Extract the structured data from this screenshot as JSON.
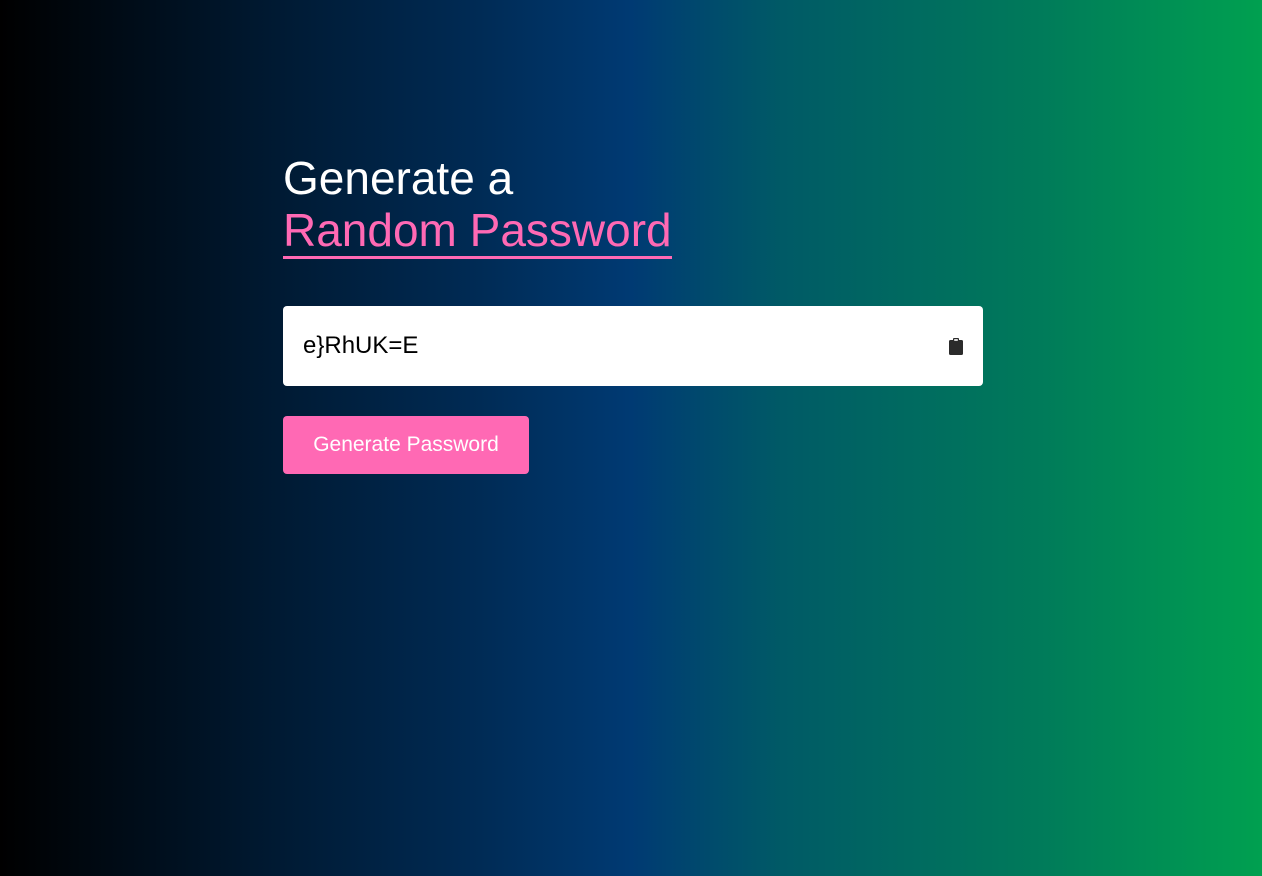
{
  "heading": {
    "line1": "Generate a",
    "line2": "Random Password"
  },
  "password_field": {
    "value": "e}RhUK=E",
    "copy_icon": "clipboard-icon"
  },
  "generate_button": {
    "label": "Generate Password"
  },
  "colors": {
    "accent": "#ff69b4",
    "gradient_start": "#000000",
    "gradient_mid": "#003a73",
    "gradient_end": "#00a050"
  }
}
